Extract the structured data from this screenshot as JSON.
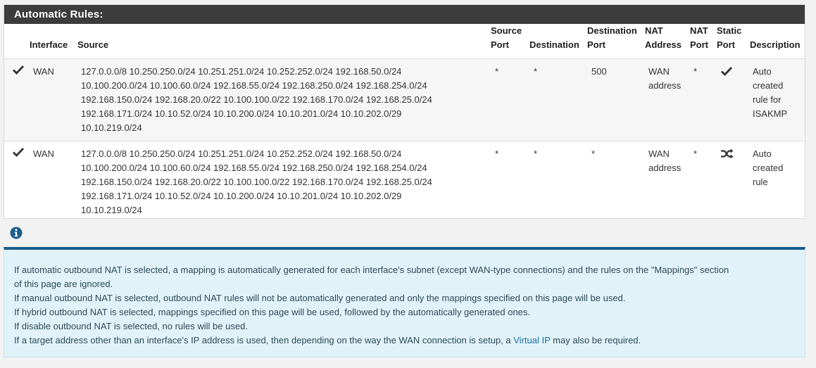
{
  "panel": {
    "title": "Automatic Rules:"
  },
  "columns": {
    "interface": "Interface",
    "source": "Source",
    "source_port_1": "Source",
    "source_port_2": "Port",
    "destination": "Destination",
    "destination_port_1": "Destination",
    "destination_port_2": "Port",
    "nat_address_1": "NAT",
    "nat_address_2": "Address",
    "nat_port_1": "NAT",
    "nat_port_2": "Port",
    "static_port_1": "Static",
    "static_port_2": "Port",
    "description": "Description"
  },
  "rows": [
    {
      "status_icon": "check-icon",
      "interface": "WAN",
      "source_lines": [
        "127.0.0.0/8 10.250.250.0/24 10.251.251.0/24 10.252.252.0/24 192.168.50.0/24",
        "10.100.200.0/24 10.100.60.0/24 192.168.55.0/24 192.168.250.0/24 192.168.254.0/24",
        "192.168.150.0/24 192.168.20.0/22 10.100.100.0/22 192.168.170.0/24 192.168.25.0/24",
        "192.168.171.0/24 10.10.52.0/24 10.10.200.0/24 10.10.201.0/24 10.10.202.0/29",
        "10.10.219.0/24"
      ],
      "source_port": "*",
      "destination": "*",
      "destination_port": "500",
      "nat_address_lines": [
        "WAN",
        "address"
      ],
      "nat_port": "*",
      "static_port_icon": "check-icon",
      "description_lines": [
        "Auto",
        "created",
        "rule for",
        "ISAKMP"
      ]
    },
    {
      "status_icon": "check-icon",
      "interface": "WAN",
      "source_lines": [
        "127.0.0.0/8 10.250.250.0/24 10.251.251.0/24 10.252.252.0/24 192.168.50.0/24",
        "10.100.200.0/24 10.100.60.0/24 192.168.55.0/24 192.168.250.0/24 192.168.254.0/24",
        "192.168.150.0/24 192.168.20.0/22 10.100.100.0/22 192.168.170.0/24 192.168.25.0/24",
        "192.168.171.0/24 10.10.52.0/24 10.10.200.0/24 10.10.201.0/24 10.10.202.0/29",
        "10.10.219.0/24"
      ],
      "source_port": "*",
      "destination": "*",
      "destination_port": "*",
      "nat_address_lines": [
        "WAN",
        "address"
      ],
      "nat_port": "*",
      "static_port_icon": "shuffle-icon",
      "description_lines": [
        "Auto",
        "created",
        "rule"
      ]
    }
  ],
  "info": {
    "icon": "info-icon",
    "line1": "If automatic outbound NAT is selected, a mapping is automatically generated for each interface's subnet (except WAN-type connections) and the rules on the \"Mappings\" section",
    "line1b": "of this page are ignored.",
    "line2": "If manual outbound NAT is selected, outbound NAT rules will not be automatically generated and only the mappings specified on this page will be used.",
    "line3": "If hybrid outbound NAT is selected, mappings specified on this page will be used, followed by the automatically generated ones.",
    "line4": "If disable outbound NAT is selected, no rules will be used.",
    "line5_pre": "If a target address other than an interface's IP address is used, then depending on the way the WAN connection is setup, a ",
    "line5_link": "Virtual IP",
    "line5_post": " may also be required."
  }
}
